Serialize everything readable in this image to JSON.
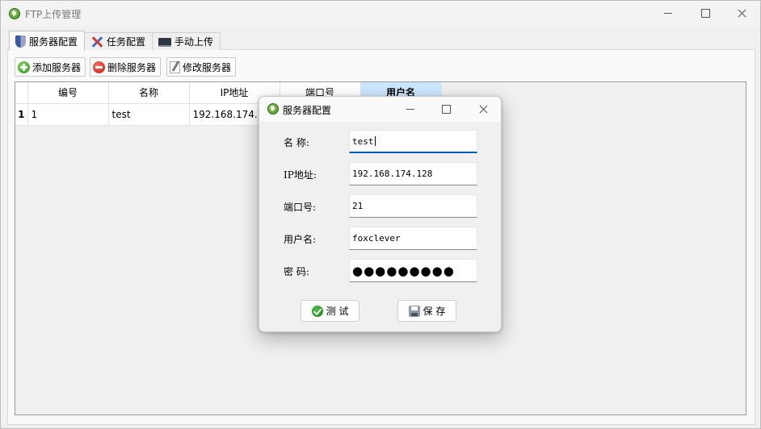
{
  "window": {
    "title": "FTP上传管理"
  },
  "tabs": [
    {
      "label": "服务器配置",
      "icon": "shield-icon",
      "active": true
    },
    {
      "label": "任务配置",
      "icon": "tools-icon",
      "active": false
    },
    {
      "label": "手动上传",
      "icon": "monitor-icon",
      "active": false
    }
  ],
  "toolbar": {
    "add_label": "添加服务器",
    "delete_label": "删除服务器",
    "edit_label": "修改服务器"
  },
  "table": {
    "columns": [
      "编号",
      "名称",
      "IP地址",
      "端口号",
      "用户名"
    ],
    "selected_column": "用户名",
    "rows": [
      {
        "row_number": "1",
        "id": "1",
        "name": "test",
        "ip": "192.168.174.128"
      }
    ]
  },
  "dialog": {
    "title": "服务器配置",
    "fields": {
      "name_label": "名  称:",
      "name_value": "test",
      "ip_label": "IP地址:",
      "ip_value": "192.168.174.128",
      "port_label": "端口号:",
      "port_value": "21",
      "user_label": "用户名:",
      "user_value": "foxclever",
      "password_label": "密  码:",
      "password_mask": "●●●●●●●●●"
    },
    "test_label": "测  试",
    "save_label": "保  存"
  }
}
